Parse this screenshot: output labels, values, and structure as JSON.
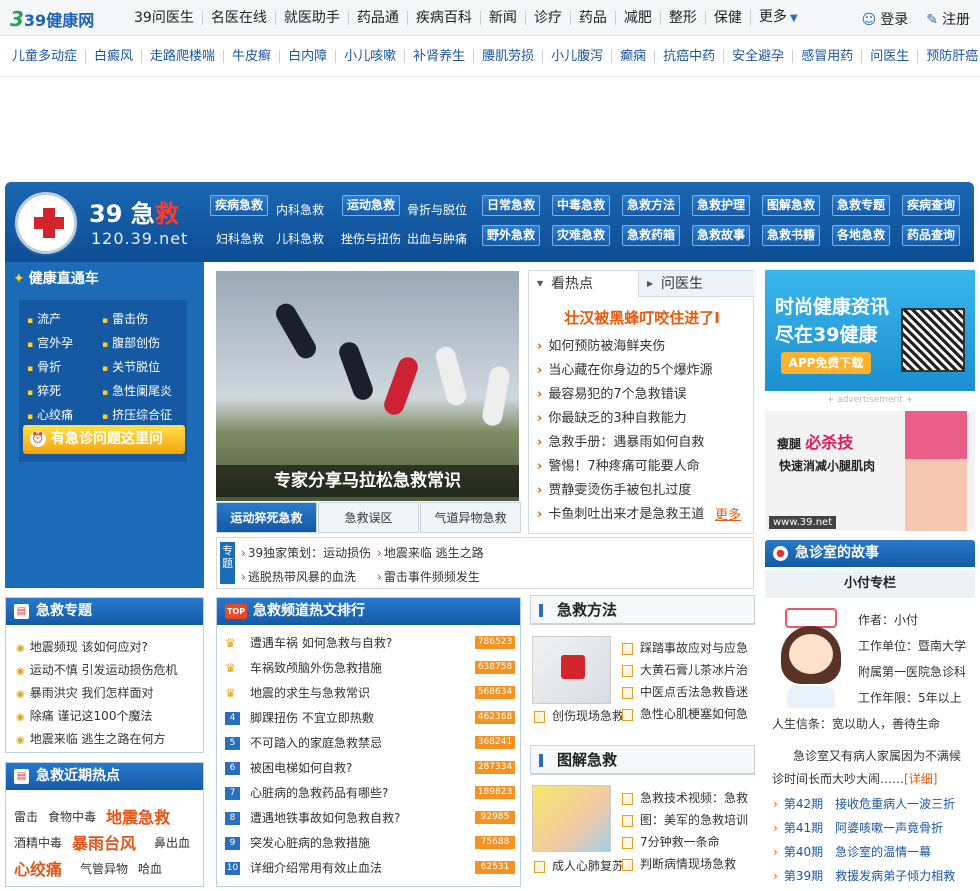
{
  "topnav": {
    "logo": "39健康网",
    "items": [
      "39问医生",
      "名医在线",
      "就医助手",
      "药品通",
      "疾病百科",
      "新闻",
      "诊疗",
      "药品",
      "减肥",
      "整形",
      "保健",
      "更多"
    ],
    "login": "登录",
    "register": "注册"
  },
  "subnav": [
    "儿童多动症",
    "白癜风",
    "走路爬楼喘",
    "牛皮癣",
    "白内障",
    "小儿咳嗽",
    "补肾养生",
    "腰肌劳损",
    "小儿腹泻",
    "癫痫",
    "抗癌中药",
    "安全避孕",
    "感冒用药",
    "问医生",
    "预防肝癌"
  ],
  "channel": {
    "title_prefix": "39 急",
    "title_red": "救",
    "url": "120.39.net",
    "btn_jibing": "疾病急救",
    "link_neike": "内科急救",
    "btn_yundong": "运动急救",
    "link_guzhe": "骨折与脱位",
    "link_fuke": "妇科急救",
    "link_erke": "儿科急救",
    "link_cishang": "挫伤与扭伤",
    "link_chuxue": "出血与肿痛",
    "row1": [
      "日常急救",
      "中毒急救",
      "急救方法",
      "急救护理",
      "图解急救",
      "急救专题",
      "疾病查询"
    ],
    "row2": [
      "野外急救",
      "灾难急救",
      "急救药箱",
      "急救故事",
      "急救书籍",
      "各地急救",
      "药品查询"
    ]
  },
  "ztc": {
    "title": "健康直通车",
    "items": [
      "流产",
      "雷击伤",
      "宫外孕",
      "腹部创伤",
      "骨折",
      "关节脱位",
      "猝死",
      "急性阑尾炎",
      "心绞痛",
      "挤压综合征"
    ],
    "ask": "有急诊问题这里问"
  },
  "banner": {
    "caption": "专家分享马拉松急救常识",
    "tabs": [
      "运动猝死急救",
      "急救误区",
      "气道异物急救"
    ]
  },
  "hot": {
    "tab1": "看热点",
    "tab2": "问医生",
    "headline": "壮汉被黑蜂叮咬住进了I",
    "items": [
      "如何预防被海鲜夹伤",
      "当心藏在你身边的5个爆炸源",
      "最容易犯的7个急救错误",
      "你最缺乏的3种自救能力",
      "急救手册：遇暴雨如何自救",
      "警惕！7种疼痛可能要人命",
      "贾静雯烫伤手被包扎过度",
      "卡鱼刺吐出来才是急救王道"
    ],
    "more": "更多"
  },
  "ad_top": {
    "line1": "时尚健康资讯",
    "line2": "尽在39健康",
    "app": "APP免费下载"
  },
  "ad_label": "+ advertisement +",
  "ad_bot": {
    "line1a": "瘦腿",
    "line1b": "必杀技",
    "line2": "快速消减小腿肌肉",
    "url": "www.39.net"
  },
  "spec": {
    "tag": "专题",
    "items": [
      "39独家策划：运动损伤",
      "地震来临 逃生之路",
      "逃脱热带风暴的血洗",
      "雷击事件频频发生"
    ]
  },
  "zhuanti": {
    "title": "急救专题",
    "items": [
      "地震频现 该如何应对?",
      "运动不慎 引发运动损伤危机",
      "暴雨洪灾 我们怎样面对",
      "除痛 谨记这100个魔法",
      "地震来临 逃生之路在何方"
    ]
  },
  "jinqi": {
    "title": "急救近期热点",
    "tags": [
      "雷击",
      "食物中毒",
      "地震急救",
      "酒精中毒",
      "暴雨台风",
      "鼻出血",
      "心绞痛",
      "气管异物",
      "哈血"
    ]
  },
  "rank": {
    "title": "急救频道热文排行",
    "badge": "TOP",
    "items": [
      {
        "no": "1",
        "text": "遭遇车祸 如何急救与自救?",
        "count": "786523"
      },
      {
        "no": "2",
        "text": "车祸致颅脑外伤急救措施",
        "count": "638758"
      },
      {
        "no": "3",
        "text": "地震的求生与急救常识",
        "count": "568634"
      },
      {
        "no": "4",
        "text": "脚踝扭伤 不宜立即热敷",
        "count": "462368"
      },
      {
        "no": "5",
        "text": "不可踏入的家庭急救禁忌",
        "count": "368241"
      },
      {
        "no": "6",
        "text": "被困电梯如何自救?",
        "count": "287334"
      },
      {
        "no": "7",
        "text": "心脏病的急救药品有哪些?",
        "count": "189823"
      },
      {
        "no": "8",
        "text": "遭遇地铁事故如何急救自救?",
        "count": "92985"
      },
      {
        "no": "9",
        "text": "突发心脏病的急救措施",
        "count": "75688"
      },
      {
        "no": "10",
        "text": "详细介绍常用有效止血法",
        "count": "62531"
      }
    ]
  },
  "method": {
    "title": "急救方法",
    "thumb": "创伤现场急救",
    "items": [
      "踩踏事故应对与应急",
      "大黄石膏儿茶冰片治",
      "中医点舌法急救昏迷",
      "急性心肌梗塞如何急"
    ]
  },
  "tujie": {
    "title": "图解急救",
    "thumb": "成人心肺复苏",
    "items": [
      "急救技术视频：急救",
      "图：美军的急救培训",
      "7分钟救一条命",
      "判断病情现场急救"
    ]
  },
  "story": {
    "title": "急诊室的故事",
    "column": "小付专栏",
    "author": "作者：小付",
    "unit1": "工作单位：暨南大学",
    "unit2": "附属第一医院急诊科",
    "years": "工作年限：5年以上",
    "motto": "人生信条：宽以助人，善待生命",
    "desc1": "急诊室又有病人家属因为不满候",
    "desc2": "诊时间长而大吵大闹……",
    "detail": "[详细]",
    "items": [
      {
        "ep": "第42期",
        "text": "接收危重病人一波三折"
      },
      {
        "ep": "第41期",
        "text": "阿婆咳嗽一声竟骨折"
      },
      {
        "ep": "第40期",
        "text": "急诊室的温情一幕"
      },
      {
        "ep": "第39期",
        "text": "救援发病弟子倾力相救"
      }
    ]
  }
}
